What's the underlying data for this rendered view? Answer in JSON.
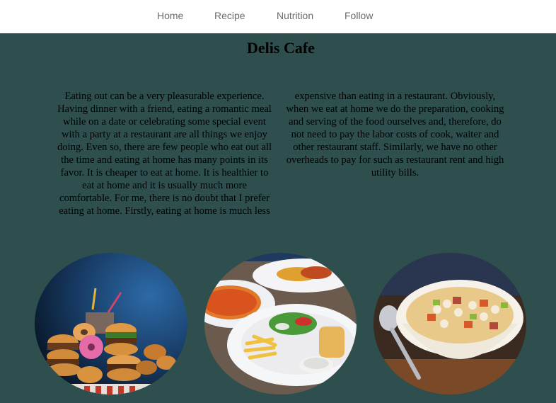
{
  "nav": {
    "items": [
      "Home",
      "Recipe",
      "Nutrition",
      "Follow"
    ]
  },
  "page": {
    "title": "Delis Cafe",
    "body": "Eating out can be a very pleasurable experience. Having dinner with a friend, eating a romantic meal while on a date or celebrating some special event with a party at a restaurant are all things we enjoy doing. Even so, there are few people who eat out all the time and eating at home has many points in its favor. It is cheaper to eat at home. It is healthier to eat at home and it is usually much more comfortable. For me, there is no doubt that I prefer eating at home. Firstly, eating at home is much less expensive than eating in a restaurant. Obviously, when we eat at home we do the preparation, cooking and serving of the food ourselves and, therefore, do not need to pay the labor costs of cook, waiter and other restaurant staff. Similarly, we have no other overheads to pay for such as restaurant rent and high utility bills."
  },
  "images": [
    {
      "icon": "fast-food-image"
    },
    {
      "icon": "pizza-fries-image"
    },
    {
      "icon": "bean-soup-image"
    }
  ],
  "colors": {
    "background": "#2f4f4f",
    "navbar": "#ffffff",
    "nav_text": "#6b6b6b"
  }
}
